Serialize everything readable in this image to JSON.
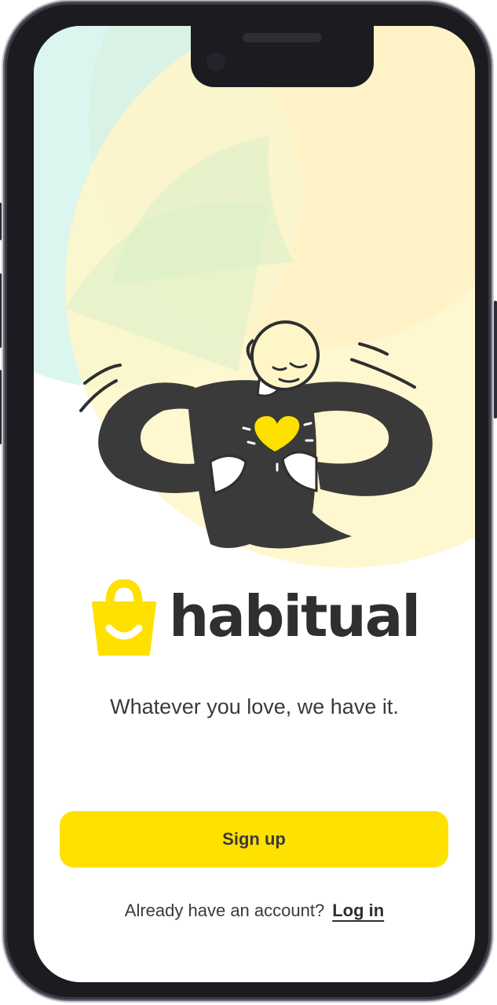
{
  "brand": {
    "name": "habitual",
    "icon": "shopping-bag-smile-icon",
    "accent_color": "#ffe100",
    "text_color": "#2f2f2f"
  },
  "illustration": {
    "icon": "person-heart-illustration",
    "heart_color": "#ffe100"
  },
  "tagline": "Whatever you love, we have it.",
  "actions": {
    "signup_label": "Sign up",
    "login_prompt": "Already have an account?",
    "login_label": "Log in"
  },
  "colors": {
    "bg_peach": "#fcdcb4",
    "bg_mint": "#d3f4ec",
    "bg_yellow": "#fff6c8",
    "bg_green": "#dbf0c9"
  }
}
